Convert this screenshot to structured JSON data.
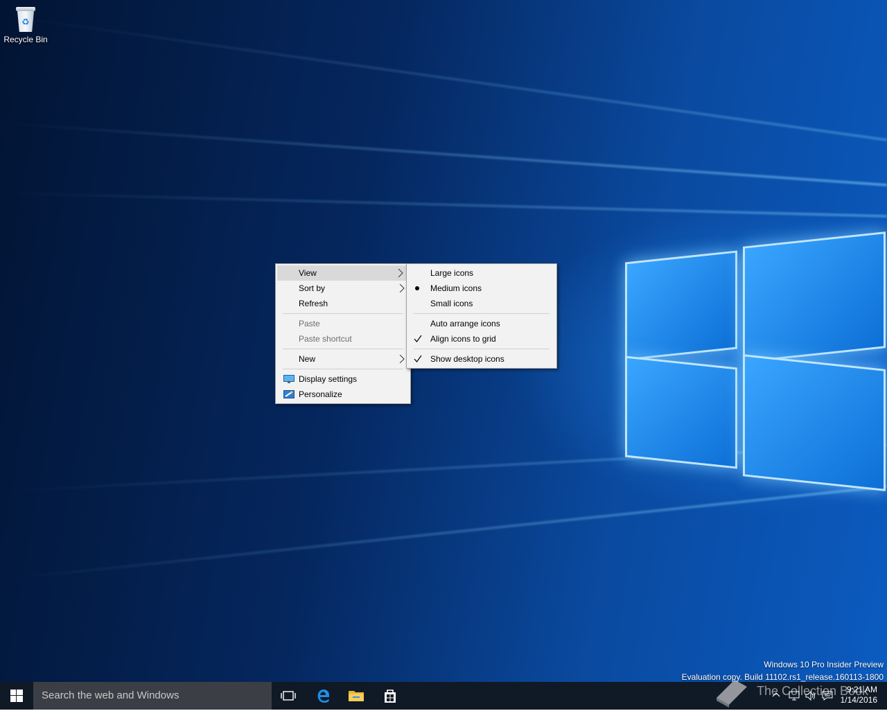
{
  "desktop": {
    "icons": [
      {
        "label": "Recycle Bin",
        "icon": "recycle-bin-icon"
      }
    ],
    "watermark": {
      "line1": "Windows 10 Pro Insider Preview",
      "line2": "Evaluation copy. Build 11102.rs1_release.160113-1800"
    }
  },
  "context_menu": {
    "items": [
      {
        "label": "View",
        "submenu": true,
        "highlighted": true
      },
      {
        "label": "Sort by",
        "submenu": true
      },
      {
        "label": "Refresh"
      },
      {
        "label": "Paste",
        "disabled": true
      },
      {
        "label": "Paste shortcut",
        "disabled": true
      },
      {
        "label": "New",
        "submenu": true
      },
      {
        "label": "Display settings",
        "icon": "display-settings-icon"
      },
      {
        "label": "Personalize",
        "icon": "personalize-icon"
      }
    ]
  },
  "view_submenu": {
    "items": [
      {
        "label": "Large icons"
      },
      {
        "label": "Medium icons",
        "selected": "bullet"
      },
      {
        "label": "Small icons"
      },
      {
        "label": "Auto arrange icons"
      },
      {
        "label": "Align icons to grid",
        "selected": "check"
      },
      {
        "label": "Show desktop icons",
        "selected": "check"
      }
    ]
  },
  "taskbar": {
    "search_placeholder": "Search the web and Windows",
    "pinned": [
      "task-view-icon",
      "edge-icon",
      "file-explorer-icon",
      "store-icon"
    ],
    "clock": {
      "time": "9:21 AM",
      "date": "1/14/2016"
    },
    "brand_watermark": "The Collection Book"
  },
  "colors": {
    "taskbar": "#101a26",
    "search_box": "#3b3f45",
    "menu_bg": "#f2f2f2",
    "menu_highlight": "#d9d9d9",
    "accent": "#0078d7"
  }
}
